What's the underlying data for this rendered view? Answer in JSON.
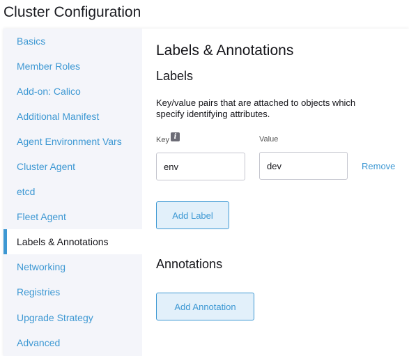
{
  "page": {
    "title": "Cluster Configuration"
  },
  "sidebar": {
    "items": [
      {
        "label": "Basics"
      },
      {
        "label": "Member Roles"
      },
      {
        "label": "Add-on: Calico"
      },
      {
        "label": "Additional Manifest"
      },
      {
        "label": "Agent Environment Vars"
      },
      {
        "label": "Cluster Agent"
      },
      {
        "label": "etcd"
      },
      {
        "label": "Fleet Agent"
      },
      {
        "label": "Labels & Annotations",
        "active": true
      },
      {
        "label": "Networking"
      },
      {
        "label": "Registries"
      },
      {
        "label": "Upgrade Strategy"
      },
      {
        "label": "Advanced"
      }
    ]
  },
  "main": {
    "title": "Labels & Annotations",
    "labels": {
      "heading": "Labels",
      "description": "Key/value pairs that are attached to objects which specify identifying attributes.",
      "key_header": "Key",
      "value_header": "Value",
      "rows": [
        {
          "key": "env",
          "value": "dev",
          "remove_label": "Remove"
        }
      ],
      "add_button": "Add Label"
    },
    "annotations": {
      "heading": "Annotations",
      "add_button": "Add Annotation"
    }
  },
  "icons": {
    "key_info": "info-icon"
  },
  "colors": {
    "accent": "#3d98d3",
    "sidebar_bg": "#f4f5fa",
    "button_bg": "#e2f0fa"
  }
}
